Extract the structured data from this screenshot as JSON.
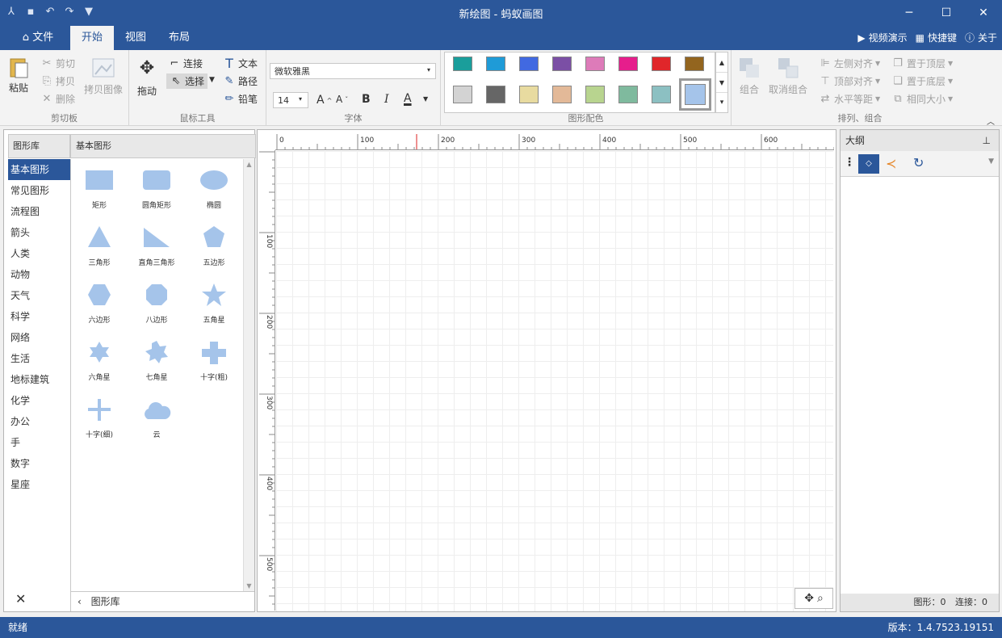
{
  "window": {
    "title": "新绘图 - 蚂蚁画图"
  },
  "tabs": [
    {
      "label": "文件"
    },
    {
      "label": "开始"
    },
    {
      "label": "视图"
    },
    {
      "label": "布局"
    }
  ],
  "tab_right": {
    "video": "视频演示",
    "shortcuts": "快捷键",
    "about": "关于"
  },
  "ribbon": {
    "clipboard": {
      "label": "剪切板",
      "paste": "粘贴",
      "cut": "剪切",
      "copy": "拷贝",
      "delete": "删除",
      "copy_image": "拷贝图像"
    },
    "mouse": {
      "label": "鼠标工具",
      "drag": "拖动",
      "connect": "连接",
      "select": "选择",
      "text": "文本",
      "path": "路径",
      "pencil": "铅笔"
    },
    "font": {
      "label": "字体",
      "family": "微软雅黑",
      "size": "14",
      "bold": "B",
      "italic": "I",
      "color": "A"
    },
    "colors": {
      "label": "图形配色",
      "row1": [
        "#1a9e9b",
        "#1f9bd7",
        "#4169e1",
        "#7b4fa5",
        "#dd7bb9",
        "#e61e8c",
        "#e0262a",
        "#93651f"
      ],
      "row2": [
        "#d3d3d3",
        "#666666",
        "#e8dba0",
        "#e3b998",
        "#b8d48f",
        "#7fba9e",
        "#8cc0c2"
      ],
      "selected": "#a5c4ea"
    },
    "arrange": {
      "label": "排列、组合",
      "group": "组合",
      "ungroup": "取消组合",
      "align_left": "左侧对齐",
      "align_top": "顶部对齐",
      "h_spacing": "水平等距",
      "bring_front": "置于顶层",
      "send_back": "置于底层",
      "same_size": "相同大小"
    }
  },
  "library": {
    "header_left": "图形库",
    "header_right": "基本图形",
    "categories": [
      "基本图形",
      "常见图形",
      "流程图",
      "箭头",
      "人类",
      "动物",
      "天气",
      "科学",
      "网络",
      "生活",
      "地标建筑",
      "化学",
      "办公",
      "手",
      "数字",
      "星座"
    ],
    "shapes": [
      "矩形",
      "圆角矩形",
      "椭圆",
      "三角形",
      "直角三角形",
      "五边形",
      "六边形",
      "八边形",
      "五角星",
      "六角星",
      "七角星",
      "十字(粗)",
      "十字(细)",
      "云"
    ],
    "footer": "图形库",
    "shape_color": "#a5c4ea"
  },
  "ruler": {
    "h": [
      "0",
      "100",
      "200",
      "300",
      "400",
      "500",
      "600"
    ],
    "v": [
      "100",
      "200",
      "300",
      "400",
      "500"
    ]
  },
  "outline": {
    "title": "大纲",
    "footer_shapes": "图形：0",
    "footer_links": "连接：0"
  },
  "status": {
    "left": "就绪",
    "right": "版本：1.4.7523.19151"
  }
}
